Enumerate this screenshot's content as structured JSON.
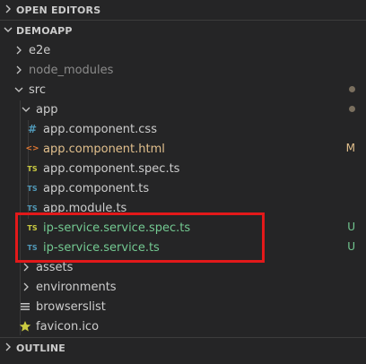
{
  "sections": {
    "open_editors": {
      "label": "OPEN EDITORS",
      "expanded": false,
      "chevron_icon": "chevron-right-icon"
    },
    "project": {
      "label": "DEMOAPP",
      "expanded": true,
      "chevron_icon": "chevron-down-icon"
    },
    "outline": {
      "label": "OUTLINE",
      "expanded": false,
      "chevron_icon": "chevron-right-icon"
    }
  },
  "tree": {
    "e2e": {
      "label": "e2e",
      "type": "folder",
      "expanded": false
    },
    "node_modules": {
      "label": "node_modules",
      "type": "folder",
      "expanded": false,
      "ignored": true
    },
    "src": {
      "label": "src",
      "type": "folder",
      "expanded": true,
      "status": "dot"
    },
    "app": {
      "label": "app",
      "type": "folder",
      "expanded": true,
      "status": "dot"
    },
    "app_css": {
      "label": "app.component.css",
      "icon": "css-hash-icon",
      "icon_text": "#"
    },
    "app_html": {
      "label": "app.component.html",
      "icon": "html-brackets-icon",
      "icon_text": "<>",
      "status": "M",
      "status_color": "#e2c08d"
    },
    "app_spec": {
      "label": "app.component.spec.ts",
      "icon": "typescript-spec-icon",
      "icon_text": "TS"
    },
    "app_ts": {
      "label": "app.component.ts",
      "icon": "typescript-icon",
      "icon_text": "TS"
    },
    "app_module": {
      "label": "app.module.ts",
      "icon": "typescript-icon",
      "icon_text": "TS"
    },
    "ip_spec": {
      "label": "ip-service.service.spec.ts",
      "icon": "typescript-spec-icon",
      "icon_text": "TS",
      "status": "U",
      "status_color": "#73c991"
    },
    "ip_service": {
      "label": "ip-service.service.ts",
      "icon": "typescript-icon",
      "icon_text": "TS",
      "status": "U",
      "status_color": "#73c991"
    },
    "assets": {
      "label": "assets",
      "type": "folder",
      "expanded": false
    },
    "environments": {
      "label": "environments",
      "type": "folder",
      "expanded": false
    },
    "browserslist": {
      "label": "browserslist",
      "icon": "lines-icon"
    },
    "favicon": {
      "label": "favicon.ico",
      "icon": "star-icon"
    }
  },
  "colors": {
    "background": "#252526",
    "modified": "#e2c08d",
    "untracked": "#73c991",
    "typescript": "#519aba",
    "highlight_border": "#e3191a"
  }
}
